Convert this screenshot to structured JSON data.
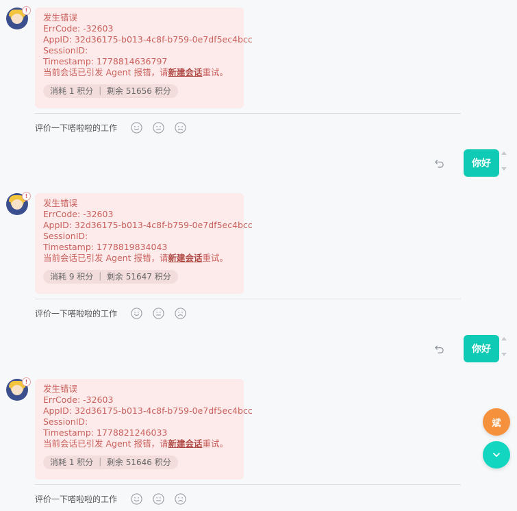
{
  "messages": [
    {
      "error_title": "发生错误",
      "err_code": "ErrCode: -32603",
      "app_id": "AppID: 32d36175-b013-4c8f-b759-0e7df5ec4bcc",
      "session_id": "SessionID:",
      "timestamp": "Timestamp: 1778814636797",
      "notice_prefix": "当前会话已引发 Agent 报错，请",
      "notice_link": "新建会话",
      "notice_suffix": "重试。",
      "cost": "消耗 1 积分 ｜ 剩余 51656 积分"
    },
    {
      "error_title": "发生错误",
      "err_code": "ErrCode: -32603",
      "app_id": "AppID: 32d36175-b013-4c8f-b759-0e7df5ec4bcc",
      "session_id": "SessionID:",
      "timestamp": "Timestamp: 1778819834043",
      "notice_prefix": "当前会话已引发 Agent 报错，请",
      "notice_link": "新建会话",
      "notice_suffix": "重试。",
      "cost": "消耗 9 积分 ｜ 剩余 51647 积分"
    },
    {
      "error_title": "发生错误",
      "err_code": "ErrCode: -32603",
      "app_id": "AppID: 32d36175-b013-4c8f-b759-0e7df5ec4bcc",
      "session_id": "SessionID:",
      "timestamp": "Timestamp: 1778821246033",
      "notice_prefix": "当前会话已引发 Agent 报错，请",
      "notice_link": "新建会话",
      "notice_suffix": "重试。",
      "cost": "消耗 1 积分 ｜ 剩余 51646 积分"
    }
  ],
  "rating_prompt": "评价一下嗒啦啦的工作",
  "rating_icons": [
    "smile-face-icon",
    "neutral-face-icon",
    "sad-face-icon"
  ],
  "user_messages": [
    "你好",
    "你好"
  ],
  "badge_glyph": "!",
  "fab_label": "斌",
  "colors": {
    "error_bg": "#fdeaea",
    "error_text": "#c9615d",
    "user_bubble": "#0fcab4",
    "fab_orange": "#f5913c",
    "fab_teal": "#13d6c0",
    "page_bg": "#f7f8fa"
  }
}
